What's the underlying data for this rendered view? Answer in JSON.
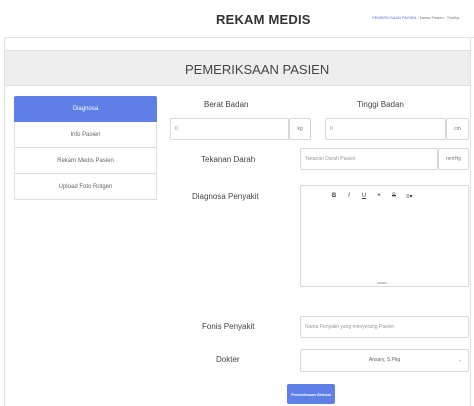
{
  "header": {
    "title": "REKAM MEDIS",
    "breadcrumb_link": "PEMERIKSAAN PASIEN",
    "breadcrumb_sep": " / ",
    "breadcrumb_current": "Nama Pasien : Shelby"
  },
  "section": {
    "title": "PEMERIKSAAN PASIEN"
  },
  "nav": {
    "items": [
      {
        "label": "Diagnosa",
        "active": true
      },
      {
        "label": "Info Pasien"
      },
      {
        "label": "Rekam Medis Pasien"
      },
      {
        "label": "Upload Foto Rotgen"
      }
    ]
  },
  "form": {
    "berat_badan": {
      "label": "Berat Badan",
      "value": "0",
      "unit": "kg"
    },
    "tinggi_badan": {
      "label": "Tinggi Badan",
      "value": "0",
      "unit": "cm"
    },
    "tekanan_darah": {
      "label": "Tekanan Darah",
      "placeholder": "Tekanan Darah Pasien",
      "unit": "mmHg"
    },
    "diagnosa": {
      "label": "Diagnosa Penyakit",
      "toolbar": [
        "B",
        "I",
        "U",
        "❝",
        "S",
        "≡▾"
      ]
    },
    "fonis": {
      "label": "Fonis Penyakit",
      "placeholder": "Nama Penyakit yang menyerang Pasien"
    },
    "dokter": {
      "label": "Dokter",
      "selected": "Ansary, S.Pkg",
      "caret": "⌄"
    },
    "submit_label": "Pemeriksaan Selesai"
  },
  "colors": {
    "accent": "#5f7fe8",
    "section_bg": "#eeeeee"
  }
}
